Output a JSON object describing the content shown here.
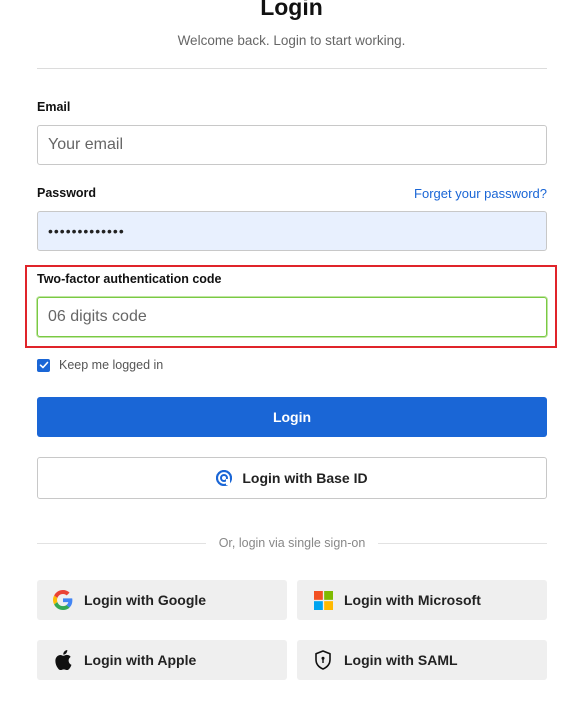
{
  "header": {
    "title": "Login",
    "subtitle": "Welcome back. Login to start working."
  },
  "form": {
    "email": {
      "label": "Email",
      "placeholder": "Your email",
      "value": ""
    },
    "password": {
      "label": "Password",
      "value": "•••••••••••••",
      "forgot_link": "Forget your password?"
    },
    "two_factor": {
      "label": "Two-factor authentication code",
      "placeholder": "06 digits code",
      "value": ""
    },
    "remember": {
      "label": "Keep me logged in",
      "checked": true
    },
    "login_button": "Login",
    "base_id_button": "Login with Base ID"
  },
  "sso": {
    "divider_text": "Or, login via single sign-on",
    "buttons": [
      {
        "label": "Login with Google",
        "icon": "google-icon"
      },
      {
        "label": "Login with Microsoft",
        "icon": "microsoft-icon"
      },
      {
        "label": "Login with Apple",
        "icon": "apple-icon"
      },
      {
        "label": "Login with SAML",
        "icon": "shield-icon"
      }
    ]
  },
  "colors": {
    "primary": "#1a66d6",
    "highlight": "#e0242a",
    "focus_border": "#7ac943",
    "autofill_bg": "#e8f0fe"
  }
}
